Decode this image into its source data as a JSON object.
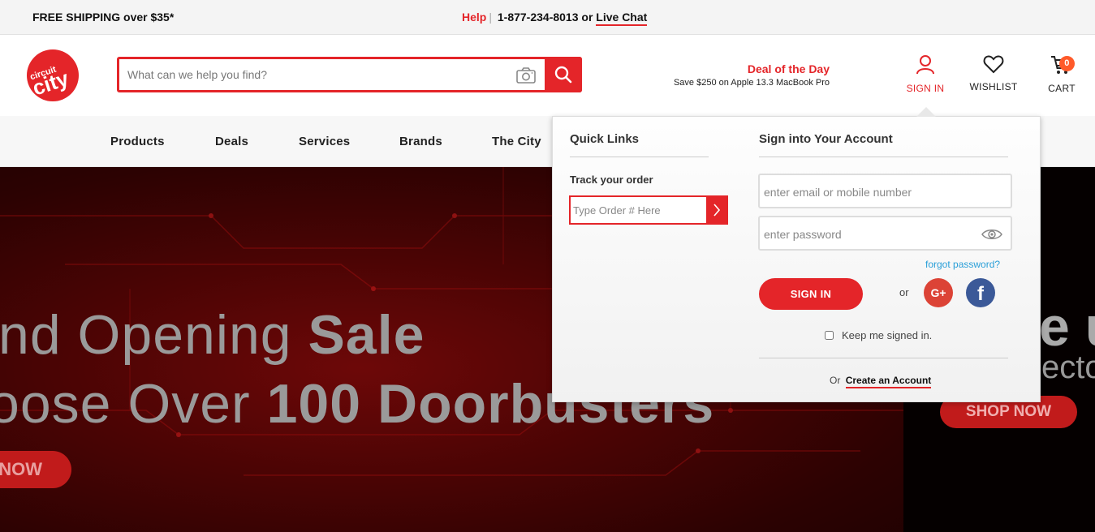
{
  "topbar": {
    "shipping": "FREE SHIPPING over $35*",
    "help": "Help",
    "separator": "|",
    "phone": "1-877-234-8013 or",
    "live_chat": "Live Chat"
  },
  "header": {
    "search_placeholder": "What can we help you find?",
    "deal_title": "Deal of the Day",
    "deal_subtitle": "Save $250 on Apple 13.3 MacBook Pro",
    "sign_in": "SIGN IN",
    "wishlist": "WISHLIST",
    "cart": "CART",
    "cart_count": "0",
    "logo_icon": "circuit-city-logo"
  },
  "nav": {
    "items": [
      "Products",
      "Deals",
      "Services",
      "Brands",
      "The City"
    ]
  },
  "hero": {
    "line1_light": "nd Opening ",
    "line1_bold": "Sale",
    "line2_light": "oose Over ",
    "line2_bold": "100 Doorbusters",
    "button_left": "NOW",
    "right_line1": "e u",
    "right_line2": "ecto",
    "button_right": "SHOP NOW"
  },
  "dropdown": {
    "quick_links_title": "Quick Links",
    "track_order_label": "Track your order",
    "order_placeholder": "Type Order # Here",
    "sign_in_title": "Sign into Your Account",
    "email_placeholder": "enter email or mobile number",
    "password_placeholder": "enter password",
    "forgot": "forgot password?",
    "sign_in_button": "SIGN IN",
    "or": "or",
    "google": "G+",
    "facebook": "f",
    "keep_signed_in": "Keep me signed in.",
    "create_prefix": "Or",
    "create_link": "Create an Account"
  },
  "colors": {
    "brand_red": "#e42529",
    "link_blue": "#2a9fd8",
    "google_red": "#dc4336",
    "facebook_blue": "#3b5998",
    "badge_orange": "#ff5a2a"
  }
}
